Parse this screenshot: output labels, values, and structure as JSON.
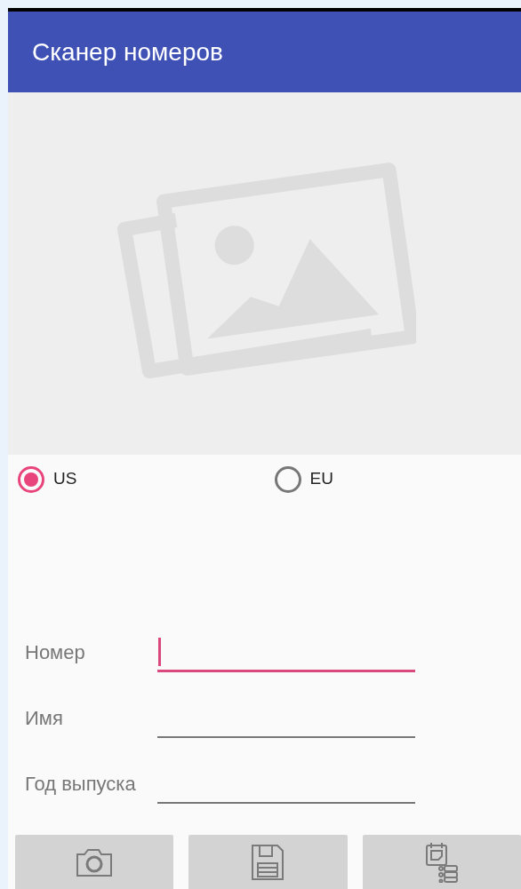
{
  "app_bar": {
    "title": "Сканер номеров"
  },
  "region_options": [
    {
      "label": "US",
      "selected": true
    },
    {
      "label": "EU",
      "selected": false
    }
  ],
  "fields": [
    {
      "label": "Номер",
      "focused": true
    },
    {
      "label": "Имя",
      "focused": false
    },
    {
      "label": "Год выпуска",
      "focused": false
    }
  ],
  "buttons": [
    {
      "kind": "camera"
    },
    {
      "kind": "save"
    },
    {
      "kind": "list"
    }
  ]
}
